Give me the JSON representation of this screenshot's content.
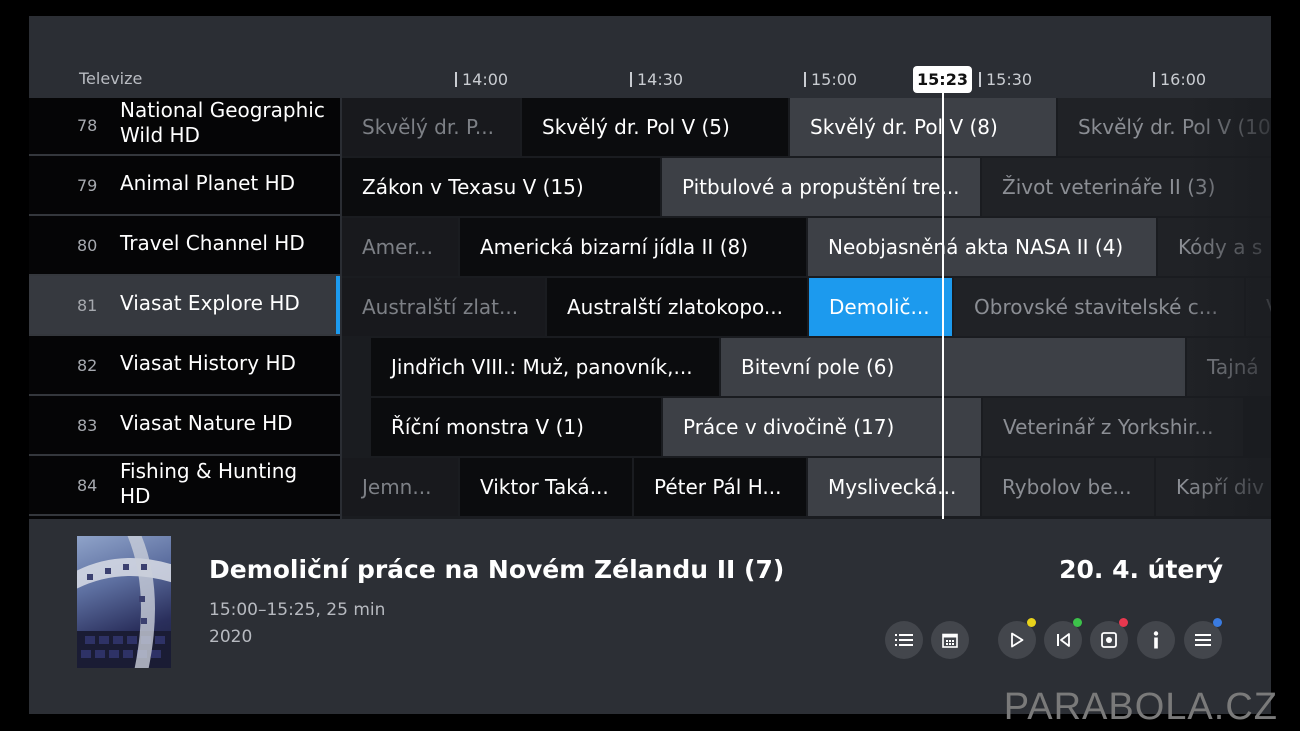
{
  "header": {
    "section_label": "Televize",
    "time_ticks": [
      "14:00",
      "14:30",
      "15:00",
      "15:30",
      "16:00"
    ],
    "current_time": "15:23"
  },
  "channels": [
    {
      "number": "78",
      "name": "National Geographic Wild HD"
    },
    {
      "number": "79",
      "name": "Animal Planet HD"
    },
    {
      "number": "80",
      "name": "Travel Channel HD"
    },
    {
      "number": "81",
      "name": "Viasat Explore HD",
      "selected": true
    },
    {
      "number": "82",
      "name": "Viasat History HD"
    },
    {
      "number": "83",
      "name": "Viasat Nature HD"
    },
    {
      "number": "84",
      "name": "Fishing & Hunting HD"
    }
  ],
  "guide": {
    "rows": [
      {
        "programs": [
          "Skvělý dr. P...",
          "Skvělý dr. Pol V (5)",
          "Skvělý dr. Pol V (8)",
          "Skvělý dr. Pol V (10)"
        ]
      },
      {
        "programs": [
          "Zákon v Texasu V (15)",
          "Pitbulové a propuštění tre...",
          "Život veterináře II (3)"
        ]
      },
      {
        "programs": [
          "Amer...",
          "Americká bizarní jídla II (8)",
          "Neobjasněná akta NASA II (4)",
          "Kódy a s"
        ]
      },
      {
        "programs": [
          "Australští zlat...",
          "Australští zlatokopo...",
          "Demolič...",
          "Obrovské stavitelské c...",
          "V"
        ]
      },
      {
        "programs": [
          "Jindřich VIII.: Muž, panovník,...",
          "Bitevní pole (6)",
          "Tajná"
        ]
      },
      {
        "programs": [
          "Říční monstra V (1)",
          "Práce v divočině (17)",
          "Veterinář z Yorkshir..."
        ]
      },
      {
        "programs": [
          "Jemn...",
          "Viktor Taká...",
          "Péter Pál H...",
          "Myslivecká...",
          "Rybolov be...",
          "Kapří div"
        ]
      }
    ]
  },
  "details": {
    "title": "Demoliční práce na Novém Zélandu II (7)",
    "time": "15:00–15:25, 25 min",
    "year": "2020",
    "date": "20. 4. úterý"
  },
  "controls": [
    {
      "icon": "list-icon"
    },
    {
      "icon": "calendar-icon"
    },
    {
      "icon": "play-icon",
      "dot_color": "#e8d21b"
    },
    {
      "icon": "skip-back-icon",
      "dot_color": "#3cc24a"
    },
    {
      "icon": "record-icon",
      "dot_color": "#e8384f"
    },
    {
      "icon": "info-icon"
    },
    {
      "icon": "menu-icon",
      "dot_color": "#3a7be0"
    }
  ],
  "colors": {
    "accent": "#1c9aee",
    "background": "#2a2d33"
  },
  "watermark": "PARABOLA.CZ"
}
